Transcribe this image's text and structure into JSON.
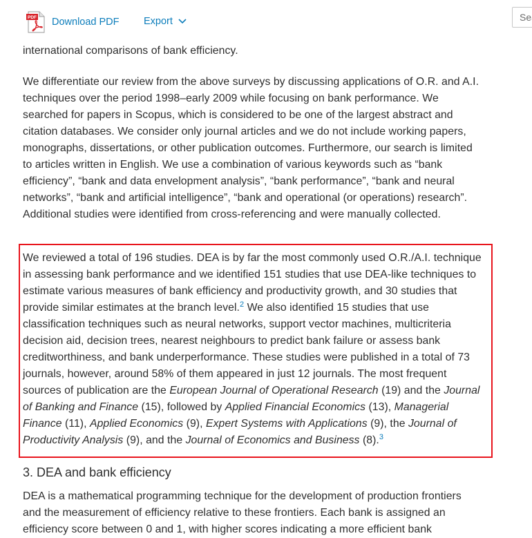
{
  "toolbar": {
    "download_pdf_label": "Download PDF",
    "pdf_badge": "PDF",
    "export_label": "Export",
    "search_placeholder": "Search"
  },
  "article": {
    "para_intro_tail": "recent applications of frontier techniques but his survey focuses only on studies that provide international comparisons of bank efficiency.",
    "para_review": "We differentiate our review from the above surveys by discussing applications of O.R. and A.I. techniques over the period 1998–early 2009 while focusing on bank performance. We searched for papers in Scopus, which is considered to be one of the largest abstract and citation databases. We consider only journal articles and we do not include working papers, monographs, dissertations, or other publication outcomes. Furthermore, our search is limited to articles written in English. We use a combination of various keywords such as “bank efficiency”, “bank and data envelopment analysis”, “bank performance”, “bank and neural networks”, “bank and artificial intelligence”, “bank and operational (or operations) research”. Additional studies were identified from cross-referencing and were manually collected.",
    "highlight": {
      "t1": "We reviewed a total of 196 studies. DEA is by far the most commonly used O.R./A.I. technique in assessing bank performance and we identified 151 studies that use DEA-like techniques to estimate various measures of bank efficiency and productivity growth, and 30 studies that provide similar estimates at the branch level.",
      "fn2": "2",
      "t2": " We also identified 15 studies that use classification techniques such as neural networks, support vector machines, multicriteria decision aid, decision trees, nearest neighbours to predict bank failure or assess bank creditworthiness, and bank underperformance. These studies were published in a total of 73 journals, however, around 58% of them appeared in just 12 journals. The most frequent sources of publication are the ",
      "j1": "European Journal of Operational Research",
      "t3": " (19) and the ",
      "j2": "Journal of Banking and Finance",
      "t4": " (15), followed by ",
      "j3": "Applied Financial Economics",
      "t5": " (13), ",
      "j4": "Managerial Finance",
      "t6": " (11), ",
      "j5": "Applied Economics",
      "t7": " (9), ",
      "j6": "Expert Systems with Applications",
      "t8": " (9), the ",
      "j7": "Journal of Productivity Analysis",
      "t9": " (9), and the ",
      "j8": "Journal of Economics and Business",
      "t10": " (8).",
      "fn3": "3"
    },
    "section_heading": "3. DEA and bank efficiency",
    "para_dea": "DEA is a mathematical programming technique for the development of production frontiers and the measurement of efficiency relative to these frontiers. Each bank is assigned an efficiency score between 0 and 1, with higher scores indicating a more efficient bank"
  },
  "colors": {
    "link": "#0c7dbb",
    "highlight_border": "#e8141c",
    "body_text": "#2e2e2e"
  }
}
